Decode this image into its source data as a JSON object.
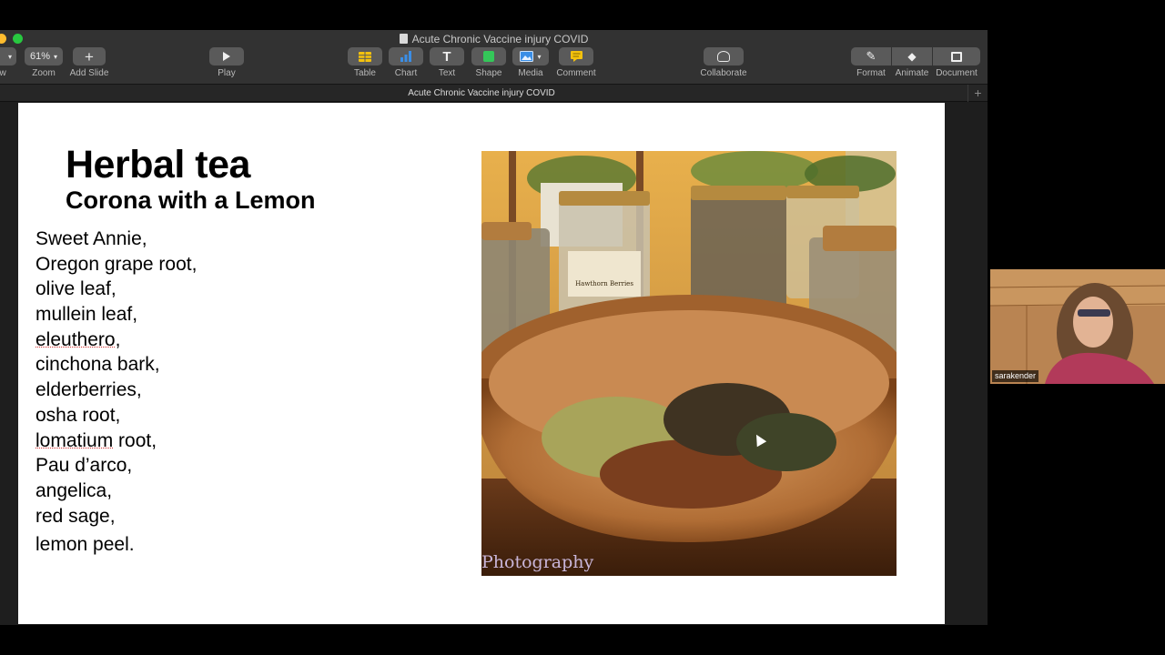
{
  "window": {
    "title": "Acute Chronic Vaccine injury COVID",
    "tab_title": "Acute Chronic Vaccine injury COVID",
    "new_tab_symbol": "+"
  },
  "toolbar": {
    "view_label": "ew",
    "zoom_value": "61%",
    "zoom_label": "Zoom",
    "add_slide_label": "Add Slide",
    "play_label": "Play",
    "table_label": "Table",
    "chart_label": "Chart",
    "text_label": "Text",
    "shape_label": "Shape",
    "media_label": "Media",
    "comment_label": "Comment",
    "collaborate_label": "Collaborate",
    "format_label": "Format",
    "animate_label": "Animate",
    "document_label": "Document"
  },
  "slide": {
    "title": "Herbal tea",
    "subtitle": "Corona with a Lemon",
    "ingredients": [
      "Sweet Annie,",
      "Oregon grape root,",
      "olive leaf,",
      "mullein leaf,",
      "eleuthero",
      "cinchona bark,",
      "elderberries,",
      "osha root,",
      "lomatium",
      "Pau d’arco,",
      "angelica,",
      "red sage,",
      "lemon peel."
    ],
    "ingredient_suffixes": {
      "eleuthero": ",",
      "lomatium": " root,"
    },
    "photo": {
      "watermark": "Photography",
      "jar_label": "Hawthorn Berries",
      "description_colors": {
        "bowl": "#b4773f",
        "wall": "#e9b24f"
      }
    }
  },
  "video": {
    "participant_name": "sarakender"
  },
  "colors": {
    "toolbar_bg": "#323232",
    "button_bg": "#5a5a5a",
    "traffic_yellow": "#febc2e",
    "traffic_green": "#28c840",
    "table_icon": "#f4c20d",
    "chart_icon": "#3a8ee6",
    "shape_icon": "#34c759",
    "comment_icon": "#f4c20d"
  }
}
